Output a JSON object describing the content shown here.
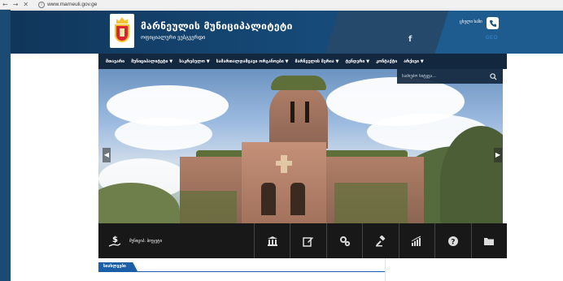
{
  "browser": {
    "back": "←",
    "forward": "→",
    "close": "✕",
    "info": "i",
    "url": "www.marneuli.gov.ge"
  },
  "header": {
    "title": "მარნეულის მუნიციპალიტეტი",
    "subtitle": "ოფიციალური ვებგვერდი",
    "facebook": "f",
    "hotline": "ცხელი ხაზი",
    "language": "GEO"
  },
  "nav": {
    "items": [
      "მთავარი",
      "მუნიციპალიტეტი ▼",
      "საკრებულო ▼",
      "სამართალდამცავი ორგანოები ▼",
      "მარნეულის მერია ▼",
      "ტენდერი ▼",
      "კონტაქტი",
      "არქივი ▼"
    ]
  },
  "search": {
    "placeholder": "საძიებო სიტყვა..."
  },
  "slider": {
    "prev": "◀",
    "next": "▶"
  },
  "quickbar": {
    "budget_label": "მუნიციპ. ბიუჯეტი",
    "budget_icon": "$"
  },
  "news": {
    "tab": "სიახლეები"
  },
  "colors": {
    "header_blue": "#154774",
    "nav_dark": "#13283f",
    "news_blue": "#1b5fa8"
  }
}
